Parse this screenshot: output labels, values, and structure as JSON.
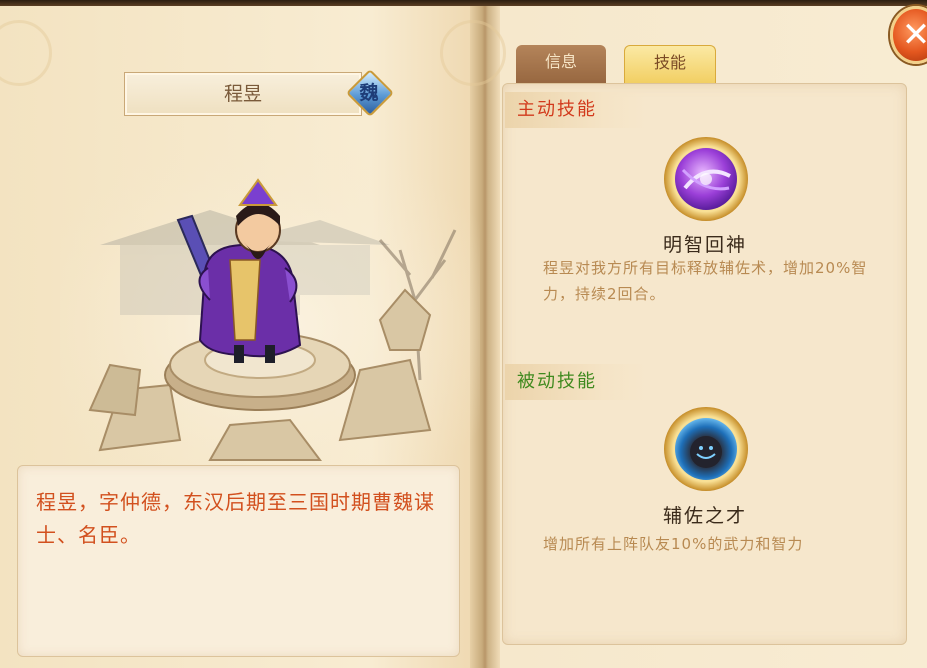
{
  "hero": {
    "name": "程昱",
    "faction": "魏",
    "bio": "程昱，字仲德，东汉后期至三国时期曹魏谋士、名臣。"
  },
  "tabs": [
    {
      "label": "信息",
      "active": false
    },
    {
      "label": "技能",
      "active": true
    }
  ],
  "sections": {
    "active_label": "主动技能",
    "passive_label": "被动技能"
  },
  "skills": {
    "active": {
      "name": "明智回神",
      "desc": "程昱对我方所有目标释放辅佐术，增加20%智力，持续2回合。",
      "icon": "purple-swirl-icon"
    },
    "passive": {
      "name": "辅佐之才",
      "desc": "增加所有上阵队友10%的武力和智力",
      "icon": "blue-orb-icon"
    }
  },
  "close_icon": "close-icon",
  "colors": {
    "active_header": "#d23a1c",
    "passive_header": "#3f8a1f",
    "bio_text": "#d2501e",
    "desc_text": "#b88a52"
  }
}
